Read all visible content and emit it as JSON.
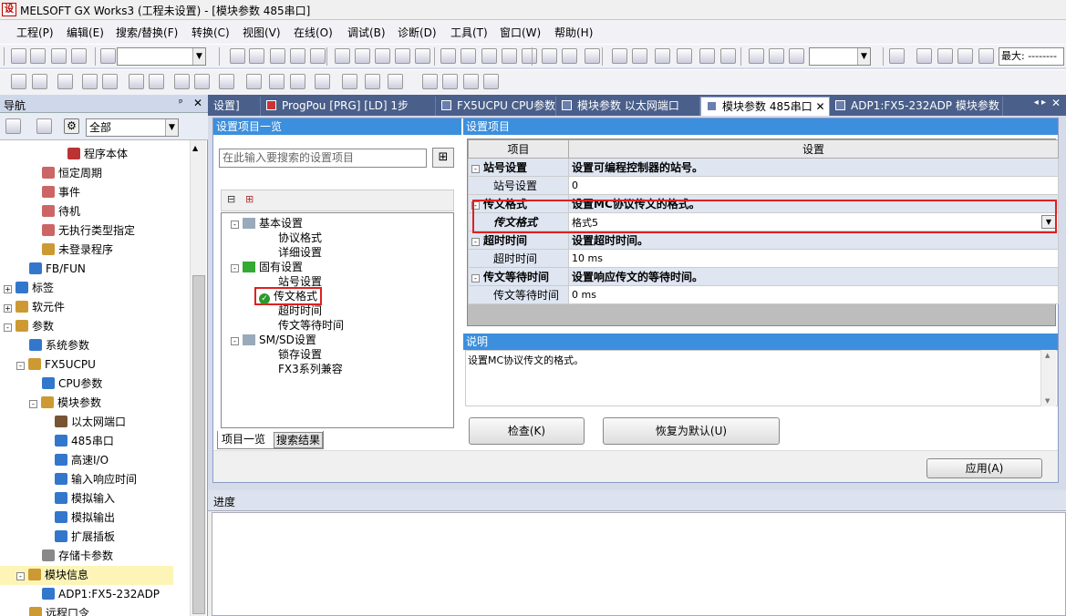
{
  "window": {
    "title": "MELSOFT GX Works3 (工程未设置) - [模块参数 485串口]",
    "icon": "melsoft-logo"
  },
  "menu": [
    "工程(P)",
    "编辑(E)",
    "搜索/替换(F)",
    "转换(C)",
    "视图(V)",
    "在线(O)",
    "调试(B)",
    "诊断(D)",
    "工具(T)",
    "窗口(W)",
    "帮助(H)"
  ],
  "toolbar": {
    "max_label": "最大: --------"
  },
  "nav": {
    "title": "导航",
    "filter": "全部",
    "items": [
      {
        "label": "程序本体",
        "indent": 5,
        "exp": "",
        "color": "#b33"
      },
      {
        "label": "恒定周期",
        "indent": 3,
        "exp": "",
        "color": "#c66"
      },
      {
        "label": "事件",
        "indent": 3,
        "exp": "",
        "color": "#c66"
      },
      {
        "label": "待机",
        "indent": 3,
        "exp": "",
        "color": "#c66"
      },
      {
        "label": "无执行类型指定",
        "indent": 3,
        "exp": "",
        "color": "#c66"
      },
      {
        "label": "未登录程序",
        "indent": 3,
        "exp": "",
        "color": "#c93"
      },
      {
        "label": "FB/FUN",
        "indent": 2,
        "exp": "",
        "color": "#37c"
      },
      {
        "label": "标签",
        "indent": 0,
        "exp": "+",
        "color": "#37c"
      },
      {
        "label": "软元件",
        "indent": 0,
        "exp": "+",
        "color": "#c93"
      },
      {
        "label": "参数",
        "indent": 0,
        "exp": "-",
        "color": "#c93"
      },
      {
        "label": "系统参数",
        "indent": 2,
        "exp": "",
        "color": "#37c"
      },
      {
        "label": "FX5UCPU",
        "indent": 1,
        "exp": "-",
        "color": "#c93"
      },
      {
        "label": "CPU参数",
        "indent": 3,
        "exp": "",
        "color": "#37c"
      },
      {
        "label": "模块参数",
        "indent": 2,
        "exp": "-",
        "color": "#c93"
      },
      {
        "label": "以太网端口",
        "indent": 4,
        "exp": "",
        "color": "#753"
      },
      {
        "label": "485串口",
        "indent": 4,
        "exp": "",
        "color": "#37c"
      },
      {
        "label": "高速I/O",
        "indent": 4,
        "exp": "",
        "color": "#37c"
      },
      {
        "label": "输入响应时间",
        "indent": 4,
        "exp": "",
        "color": "#37c"
      },
      {
        "label": "模拟输入",
        "indent": 4,
        "exp": "",
        "color": "#37c"
      },
      {
        "label": "模拟输出",
        "indent": 4,
        "exp": "",
        "color": "#37c"
      },
      {
        "label": "扩展插板",
        "indent": 4,
        "exp": "",
        "color": "#37c"
      },
      {
        "label": "存储卡参数",
        "indent": 3,
        "exp": "",
        "color": "#888"
      },
      {
        "label": "模块信息",
        "indent": 1,
        "exp": "-",
        "color": "#c93",
        "selected": true
      },
      {
        "label": "ADP1:FX5-232ADP",
        "indent": 3,
        "exp": "",
        "color": "#37c"
      },
      {
        "label": "远程口令",
        "indent": 2,
        "exp": "",
        "color": "#c93"
      }
    ]
  },
  "tabs": [
    {
      "label": "设置]",
      "w": 58
    },
    {
      "label": "ProgPou [PRG] [LD] 1步",
      "w": 192
    },
    {
      "label": "FX5UCPU CPU参数",
      "w": 132
    },
    {
      "label": "模块参数 以太网端口",
      "w": 158
    },
    {
      "label": "模块参数 485串口 ✕",
      "w": 142,
      "active": true
    },
    {
      "label": "ADP1:FX5-232ADP 模块参数",
      "w": 190
    }
  ],
  "left": {
    "header": "设置项目一览",
    "search_placeholder": "在此输入要搜索的设置项目",
    "tree": [
      {
        "label": "基本设置",
        "level": 0
      },
      {
        "label": "协议格式",
        "level": 1
      },
      {
        "label": "详细设置",
        "level": 1
      },
      {
        "label": "固有设置",
        "level": 0
      },
      {
        "label": "站号设置",
        "level": 1
      },
      {
        "label": "传文格式",
        "level": 1,
        "selected": true
      },
      {
        "label": "超时时间",
        "level": 1
      },
      {
        "label": "传文等待时间",
        "level": 1
      },
      {
        "label": "SM/SD设置",
        "level": 0
      },
      {
        "label": "锁存设置",
        "level": 1
      },
      {
        "label": "FX3系列兼容",
        "level": 1
      }
    ],
    "bottom_tabs": [
      "项目一览",
      "搜索结果"
    ]
  },
  "right": {
    "header": "设置项目",
    "col_item": "项目",
    "col_setting": "设置",
    "rows": [
      {
        "kind": "group",
        "item": "站号设置",
        "setting": "设置可编程控制器的站号。"
      },
      {
        "kind": "leaf",
        "item": "站号设置",
        "setting": "0"
      },
      {
        "kind": "group",
        "item": "传文格式",
        "setting": "设置MC协议传文的格式。"
      },
      {
        "kind": "select",
        "item": "传文格式",
        "setting": "格式5"
      },
      {
        "kind": "group",
        "item": "超时时间",
        "setting": "设置超时时间。"
      },
      {
        "kind": "leaf",
        "item": "超时时间",
        "setting": "10 ms"
      },
      {
        "kind": "group",
        "item": "传文等待时间",
        "setting": "设置响应传文的等待时间。"
      },
      {
        "kind": "leaf",
        "item": "传文等待时间",
        "setting": "0 ms"
      }
    ],
    "desc_header": "说明",
    "desc_text": "设置MC协议传文的格式。",
    "check_btn": "检查(K)",
    "reset_btn": "恢复为默认(U)",
    "apply_btn": "应用(A)"
  },
  "progress": {
    "title": "进度"
  }
}
